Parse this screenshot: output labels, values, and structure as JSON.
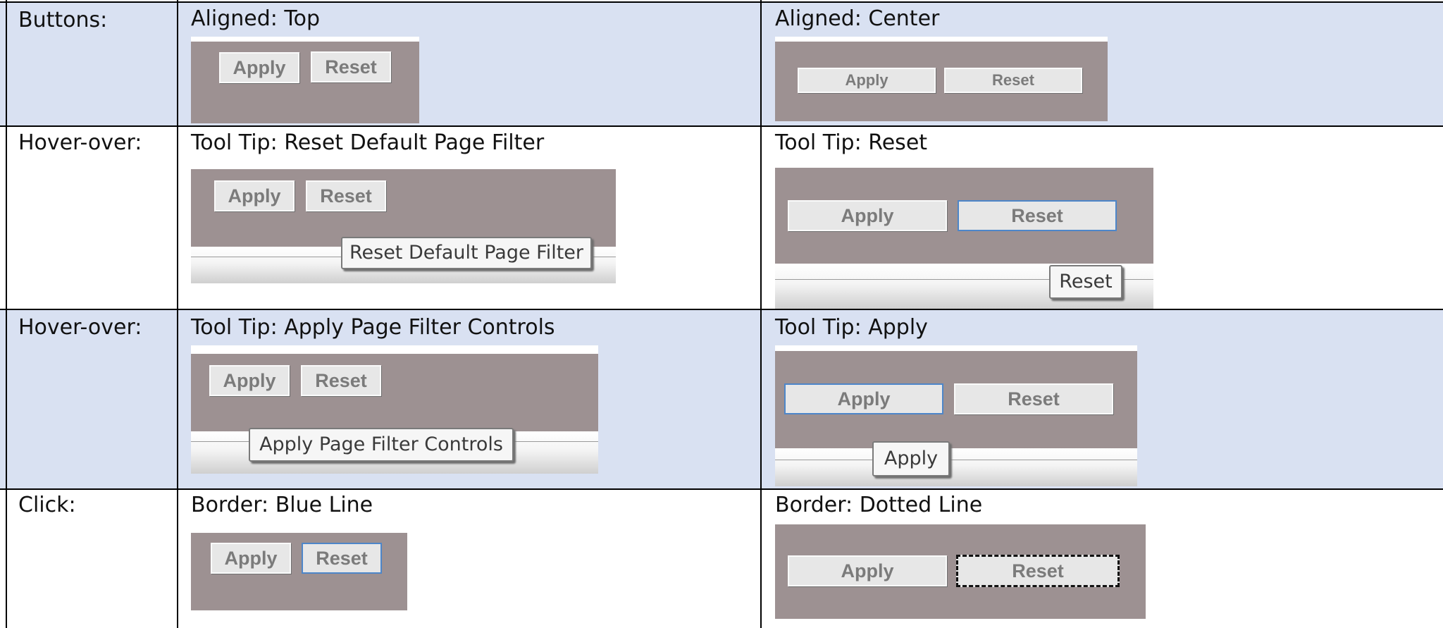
{
  "table": {
    "rows": [
      {
        "header": "Buttons:",
        "left": {
          "caption": "Aligned: Top",
          "apply": "Apply",
          "reset": "Reset"
        },
        "right": {
          "caption": "Aligned: Center",
          "apply": "Apply",
          "reset": "Reset"
        }
      },
      {
        "header": "Hover-over:",
        "left": {
          "caption": "Tool Tip: Reset Default Page Filter",
          "apply": "Apply",
          "reset": "Reset",
          "tooltip": "Reset Default Page Filter"
        },
        "right": {
          "caption": "Tool Tip: Reset",
          "apply": "Apply",
          "reset": "Reset",
          "tooltip": "Reset"
        }
      },
      {
        "header": "Hover-over:",
        "left": {
          "caption": "Tool Tip: Apply Page Filter Controls",
          "apply": "Apply",
          "reset": "Reset",
          "tooltip": "Apply Page Filter Controls"
        },
        "right": {
          "caption": "Tool Tip: Apply",
          "apply": "Apply",
          "reset": "Reset",
          "tooltip": "Apply"
        }
      },
      {
        "header": "Click:",
        "left": {
          "caption": "Border: Blue Line",
          "apply": "Apply",
          "reset": "Reset"
        },
        "right": {
          "caption": "Border: Dotted Line",
          "apply": "Apply",
          "reset": "Reset"
        }
      }
    ]
  },
  "colors": {
    "row_shade": "#d9e1f2",
    "panel": "#9d9192",
    "button_face": "#e7e7e7",
    "button_text": "#7b7b7b",
    "focus_blue": "#4d86c9"
  }
}
